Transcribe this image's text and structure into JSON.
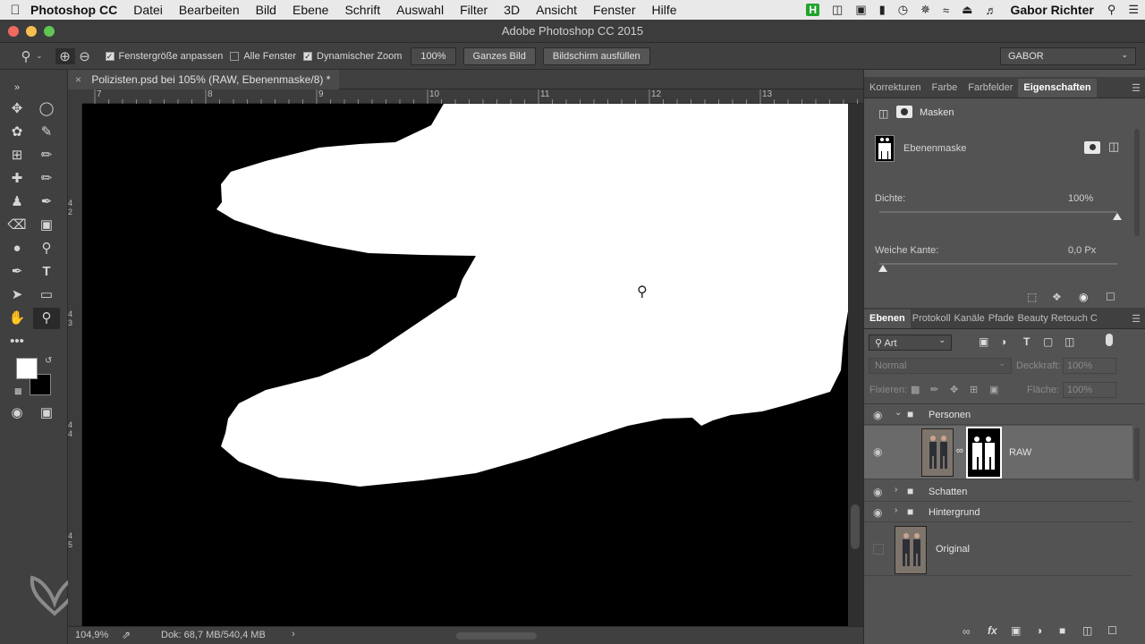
{
  "menubar": {
    "app": "Photoshop CC",
    "items": [
      "Datei",
      "Bearbeiten",
      "Bild",
      "Ebene",
      "Schrift",
      "Auswahl",
      "Filter",
      "3D",
      "Ansicht",
      "Fenster",
      "Hilfe"
    ],
    "user": "Gabor Richter"
  },
  "window": {
    "title": "Adobe Photoshop CC 2015"
  },
  "options": {
    "resize_windows": "Fenstergröße anpassen",
    "all_windows": "Alle Fenster",
    "scrubby_zoom": "Dynamischer Zoom",
    "zoom_value": "100%",
    "fit_screen": "Ganzes Bild",
    "fill_screen": "Bildschirm ausfüllen",
    "workspace": "GABOR"
  },
  "document": {
    "tab": "Polizisten.psd bei 105% (RAW, Ebenenmaske/8) *",
    "ruler_h": [
      "7",
      "8",
      "9",
      "10",
      "11",
      "12",
      "13"
    ],
    "ruler_v": [
      "4",
      "2",
      "4",
      "3",
      "4",
      "4",
      "4",
      "5"
    ],
    "status_zoom": "104,9%",
    "status_doc": "Dok: 68,7 MB/540,4 MB"
  },
  "props_panel": {
    "tabs": [
      "Korrekturen",
      "Farbe",
      "Farbfelder",
      "Eigenschaften"
    ],
    "active_tab": "Eigenschaften",
    "header": "Masken",
    "mask_name": "Ebenenmaske",
    "density_label": "Dichte:",
    "density_value": "100%",
    "feather_label": "Weiche Kante:",
    "feather_value": "0,0 Px",
    "density": 1.0,
    "feather": 0.0
  },
  "layers_panel": {
    "tabs": [
      "Ebenen",
      "Protokoll",
      "Kanäle",
      "Pfade",
      "Beauty Retouch C"
    ],
    "filter_kind": "Art",
    "blend_mode": "Normal",
    "opacity_label": "Deckkraft:",
    "opacity_value": "100%",
    "lock_label": "Fixieren:",
    "fill_label": "Fläche:",
    "fill_value": "100%",
    "layers": [
      {
        "name": "Personen",
        "type": "group-open"
      },
      {
        "name": "RAW",
        "type": "layer-mask"
      },
      {
        "name": "Schatten",
        "type": "group"
      },
      {
        "name": "Hintergrund",
        "type": "group"
      },
      {
        "name": "Original",
        "type": "layer"
      }
    ]
  }
}
